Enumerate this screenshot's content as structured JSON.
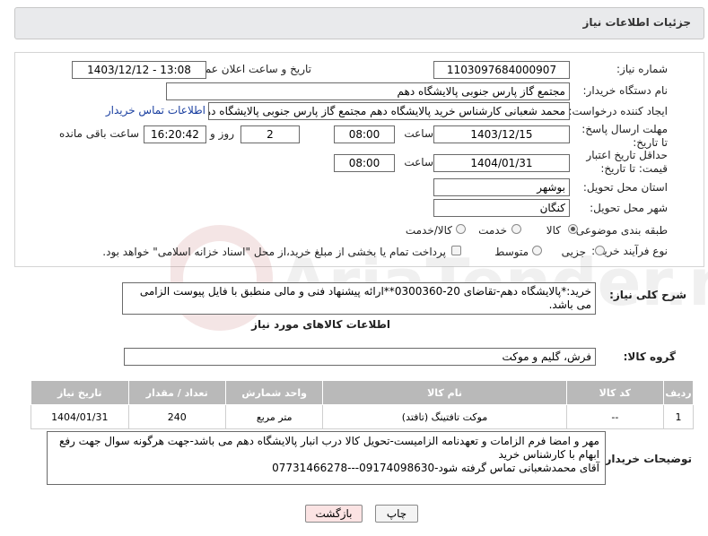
{
  "header": {
    "title": "جزئیات اطلاعات نیاز"
  },
  "form": {
    "need_number_label": "شماره نیاز:",
    "need_number": "1103097684000907",
    "announce_label": "تاریخ و ساعت اعلان عمومی:",
    "announce_value": "1403/12/12 - 13:08",
    "buyer_org_label": "نام دستگاه خریدار:",
    "buyer_org": "مجتمع گاز پارس جنوبی  پالایشگاه دهم",
    "creator_label": "ایجاد کننده درخواست:",
    "creator": "محمد شعبانی کارشناس خرید پالایشگاه دهم  مجتمع گاز پارس جنوبی  پالایشگاه دهم",
    "buyer_contact_link": "اطلاعات تماس خریدار",
    "deadline_label": "مهلت ارسال پاسخ: تا تاریخ:",
    "deadline_date": "1403/12/15",
    "time_label": "ساعت",
    "deadline_time": "08:00",
    "days_value": "2",
    "days_label": "روز و",
    "remaining_time": "16:20:42",
    "remaining_label": "ساعت باقی مانده",
    "min_validity_label": "حداقل تاریخ اعتبار قیمت: تا تاریخ:",
    "validity_date": "1404/01/31",
    "validity_time": "08:00",
    "province_label": "استان محل تحویل:",
    "province": "بوشهر",
    "city_label": "شهر محل تحویل:",
    "city": "کنگان",
    "category_label": "طبقه بندی موضوعی:",
    "category_options": [
      "کالا",
      "خدمت",
      "کالا/خدمت"
    ],
    "process_label": "نوع فرآیند خرید :",
    "process_options": [
      "جزیی",
      "متوسط"
    ],
    "payment_note": "پرداخت تمام یا بخشی از مبلغ خرید،از محل \"اسناد خزانه اسلامی\" خواهد بود."
  },
  "summary": {
    "label": "شرح کلی نیاز:",
    "text": "خرید:*پالایشگاه دهم-تقاضای 20-0300360**ارائه پیشنهاد فنی و مالی منطبق با فایل پیوست الزامی می باشد."
  },
  "goods": {
    "section_title": "اطلاعات کالاهای مورد نیاز",
    "group_label": "گروه کالا:",
    "group_value": "فرش، گلیم و موکت",
    "columns": [
      "ردیف",
      "کد کالا",
      "نام کالا",
      "واحد شمارش",
      "تعداد / مقدار",
      "تاریخ نیاز"
    ],
    "rows": [
      [
        "1",
        "--",
        "موکت تافتینگ (تافتد)",
        "متر مربع",
        "240",
        "1404/01/31"
      ]
    ]
  },
  "buyer_notes": {
    "label": "توضیحات خریدار:",
    "line1": "مهر و امضا فرم الزامات و تعهدنامه الزامیست-تحویل کالا درب انبار پالایشگاه دهم می باشد-جهت هرگونه سوال جهت رفع ابهام با کارشناس خرید",
    "line2": "آقای محمدشعبانی تماس گرفته شود-09174098630---07731466278"
  },
  "buttons": {
    "print": "چاپ",
    "back": "بازگشت"
  },
  "colors": {
    "accent_link": "#1a3fa0",
    "back_button_bg": "#fbe3e3",
    "print_button_bg": "#f4f4f4"
  },
  "watermark": {
    "text": "AriaTender.neT"
  }
}
